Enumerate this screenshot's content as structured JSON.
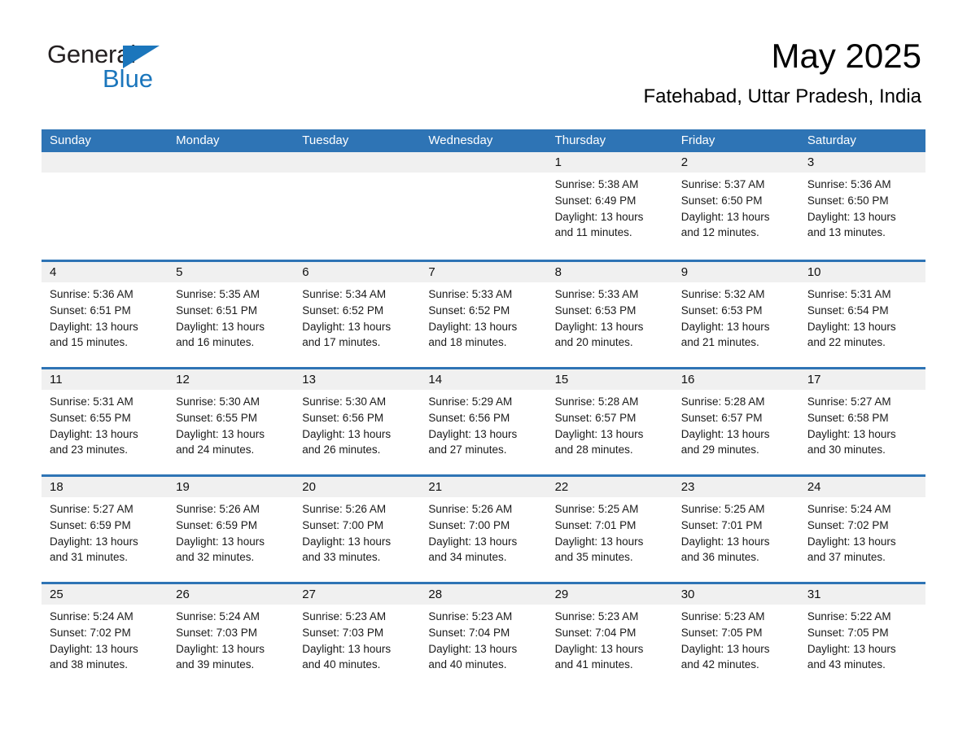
{
  "brand": {
    "name_part1": "General",
    "name_part2": "Blue",
    "accent_color": "#1b76bc"
  },
  "header": {
    "title": "May 2025",
    "subtitle": "Fatehabad, Uttar Pradesh, India"
  },
  "calendar": {
    "header_bg": "#2e74b5",
    "day_band_bg": "#f0f0f0",
    "weekday_headers": [
      "Sunday",
      "Monday",
      "Tuesday",
      "Wednesday",
      "Thursday",
      "Friday",
      "Saturday"
    ],
    "weeks": [
      [
        {
          "date": "",
          "empty": true
        },
        {
          "date": "",
          "empty": true
        },
        {
          "date": "",
          "empty": true
        },
        {
          "date": "",
          "empty": true
        },
        {
          "date": "1",
          "sunrise": "Sunrise: 5:38 AM",
          "sunset": "Sunset: 6:49 PM",
          "daylight_line1": "Daylight: 13 hours",
          "daylight_line2": "and 11 minutes."
        },
        {
          "date": "2",
          "sunrise": "Sunrise: 5:37 AM",
          "sunset": "Sunset: 6:50 PM",
          "daylight_line1": "Daylight: 13 hours",
          "daylight_line2": "and 12 minutes."
        },
        {
          "date": "3",
          "sunrise": "Sunrise: 5:36 AM",
          "sunset": "Sunset: 6:50 PM",
          "daylight_line1": "Daylight: 13 hours",
          "daylight_line2": "and 13 minutes."
        }
      ],
      [
        {
          "date": "4",
          "sunrise": "Sunrise: 5:36 AM",
          "sunset": "Sunset: 6:51 PM",
          "daylight_line1": "Daylight: 13 hours",
          "daylight_line2": "and 15 minutes."
        },
        {
          "date": "5",
          "sunrise": "Sunrise: 5:35 AM",
          "sunset": "Sunset: 6:51 PM",
          "daylight_line1": "Daylight: 13 hours",
          "daylight_line2": "and 16 minutes."
        },
        {
          "date": "6",
          "sunrise": "Sunrise: 5:34 AM",
          "sunset": "Sunset: 6:52 PM",
          "daylight_line1": "Daylight: 13 hours",
          "daylight_line2": "and 17 minutes."
        },
        {
          "date": "7",
          "sunrise": "Sunrise: 5:33 AM",
          "sunset": "Sunset: 6:52 PM",
          "daylight_line1": "Daylight: 13 hours",
          "daylight_line2": "and 18 minutes."
        },
        {
          "date": "8",
          "sunrise": "Sunrise: 5:33 AM",
          "sunset": "Sunset: 6:53 PM",
          "daylight_line1": "Daylight: 13 hours",
          "daylight_line2": "and 20 minutes."
        },
        {
          "date": "9",
          "sunrise": "Sunrise: 5:32 AM",
          "sunset": "Sunset: 6:53 PM",
          "daylight_line1": "Daylight: 13 hours",
          "daylight_line2": "and 21 minutes."
        },
        {
          "date": "10",
          "sunrise": "Sunrise: 5:31 AM",
          "sunset": "Sunset: 6:54 PM",
          "daylight_line1": "Daylight: 13 hours",
          "daylight_line2": "and 22 minutes."
        }
      ],
      [
        {
          "date": "11",
          "sunrise": "Sunrise: 5:31 AM",
          "sunset": "Sunset: 6:55 PM",
          "daylight_line1": "Daylight: 13 hours",
          "daylight_line2": "and 23 minutes."
        },
        {
          "date": "12",
          "sunrise": "Sunrise: 5:30 AM",
          "sunset": "Sunset: 6:55 PM",
          "daylight_line1": "Daylight: 13 hours",
          "daylight_line2": "and 24 minutes."
        },
        {
          "date": "13",
          "sunrise": "Sunrise: 5:30 AM",
          "sunset": "Sunset: 6:56 PM",
          "daylight_line1": "Daylight: 13 hours",
          "daylight_line2": "and 26 minutes."
        },
        {
          "date": "14",
          "sunrise": "Sunrise: 5:29 AM",
          "sunset": "Sunset: 6:56 PM",
          "daylight_line1": "Daylight: 13 hours",
          "daylight_line2": "and 27 minutes."
        },
        {
          "date": "15",
          "sunrise": "Sunrise: 5:28 AM",
          "sunset": "Sunset: 6:57 PM",
          "daylight_line1": "Daylight: 13 hours",
          "daylight_line2": "and 28 minutes."
        },
        {
          "date": "16",
          "sunrise": "Sunrise: 5:28 AM",
          "sunset": "Sunset: 6:57 PM",
          "daylight_line1": "Daylight: 13 hours",
          "daylight_line2": "and 29 minutes."
        },
        {
          "date": "17",
          "sunrise": "Sunrise: 5:27 AM",
          "sunset": "Sunset: 6:58 PM",
          "daylight_line1": "Daylight: 13 hours",
          "daylight_line2": "and 30 minutes."
        }
      ],
      [
        {
          "date": "18",
          "sunrise": "Sunrise: 5:27 AM",
          "sunset": "Sunset: 6:59 PM",
          "daylight_line1": "Daylight: 13 hours",
          "daylight_line2": "and 31 minutes."
        },
        {
          "date": "19",
          "sunrise": "Sunrise: 5:26 AM",
          "sunset": "Sunset: 6:59 PM",
          "daylight_line1": "Daylight: 13 hours",
          "daylight_line2": "and 32 minutes."
        },
        {
          "date": "20",
          "sunrise": "Sunrise: 5:26 AM",
          "sunset": "Sunset: 7:00 PM",
          "daylight_line1": "Daylight: 13 hours",
          "daylight_line2": "and 33 minutes."
        },
        {
          "date": "21",
          "sunrise": "Sunrise: 5:26 AM",
          "sunset": "Sunset: 7:00 PM",
          "daylight_line1": "Daylight: 13 hours",
          "daylight_line2": "and 34 minutes."
        },
        {
          "date": "22",
          "sunrise": "Sunrise: 5:25 AM",
          "sunset": "Sunset: 7:01 PM",
          "daylight_line1": "Daylight: 13 hours",
          "daylight_line2": "and 35 minutes."
        },
        {
          "date": "23",
          "sunrise": "Sunrise: 5:25 AM",
          "sunset": "Sunset: 7:01 PM",
          "daylight_line1": "Daylight: 13 hours",
          "daylight_line2": "and 36 minutes."
        },
        {
          "date": "24",
          "sunrise": "Sunrise: 5:24 AM",
          "sunset": "Sunset: 7:02 PM",
          "daylight_line1": "Daylight: 13 hours",
          "daylight_line2": "and 37 minutes."
        }
      ],
      [
        {
          "date": "25",
          "sunrise": "Sunrise: 5:24 AM",
          "sunset": "Sunset: 7:02 PM",
          "daylight_line1": "Daylight: 13 hours",
          "daylight_line2": "and 38 minutes."
        },
        {
          "date": "26",
          "sunrise": "Sunrise: 5:24 AM",
          "sunset": "Sunset: 7:03 PM",
          "daylight_line1": "Daylight: 13 hours",
          "daylight_line2": "and 39 minutes."
        },
        {
          "date": "27",
          "sunrise": "Sunrise: 5:23 AM",
          "sunset": "Sunset: 7:03 PM",
          "daylight_line1": "Daylight: 13 hours",
          "daylight_line2": "and 40 minutes."
        },
        {
          "date": "28",
          "sunrise": "Sunrise: 5:23 AM",
          "sunset": "Sunset: 7:04 PM",
          "daylight_line1": "Daylight: 13 hours",
          "daylight_line2": "and 40 minutes."
        },
        {
          "date": "29",
          "sunrise": "Sunrise: 5:23 AM",
          "sunset": "Sunset: 7:04 PM",
          "daylight_line1": "Daylight: 13 hours",
          "daylight_line2": "and 41 minutes."
        },
        {
          "date": "30",
          "sunrise": "Sunrise: 5:23 AM",
          "sunset": "Sunset: 7:05 PM",
          "daylight_line1": "Daylight: 13 hours",
          "daylight_line2": "and 42 minutes."
        },
        {
          "date": "31",
          "sunrise": "Sunrise: 5:22 AM",
          "sunset": "Sunset: 7:05 PM",
          "daylight_line1": "Daylight: 13 hours",
          "daylight_line2": "and 43 minutes."
        }
      ]
    ]
  }
}
